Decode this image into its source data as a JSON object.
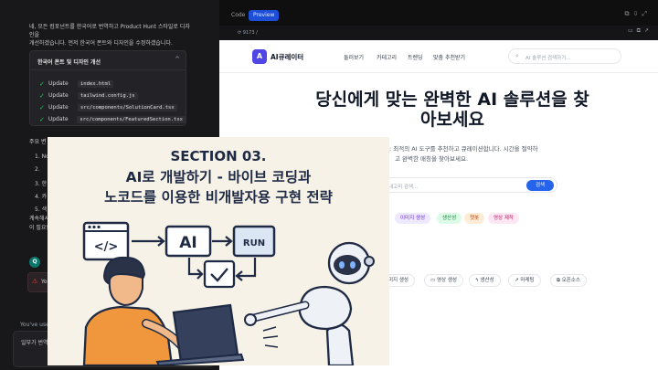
{
  "chat": {
    "intro_line1": "네, 모든 컴포넌트를 한국어로 번역하고 Product Hunt 스타일로 디자인을",
    "intro_line2": "개선하겠습니다. 먼저 한국어 폰트와 디자인을 수정하겠습니다.",
    "task_title": "한국어 폰트 및 디자인 개선",
    "task_toggle": "^",
    "tasks": [
      {
        "verb": "Update",
        "file": "index.html"
      },
      {
        "verb": "Update",
        "file": "tailwind.config.js"
      },
      {
        "verb": "Update",
        "file": "src/components/SolutionCard.tsx"
      },
      {
        "verb": "Update",
        "file": "src/components/FeaturedSection.tsx"
      }
    ],
    "section_title": "주요 변",
    "numbered": [
      "1. No",
      "2.",
      "3. 한",
      "4. 카",
      "5. 색"
    ],
    "tail_line1": "계속해서",
    "tail_line2": "이 필요한",
    "q_badge": "Q",
    "error_icon": "⚠",
    "error_text": "Yo",
    "usage_notice": "You've used",
    "compose_text": "일부가 번역이"
  },
  "ide": {
    "tab_code": "Code",
    "tab_preview": "Preview",
    "url": "⟳ 9173 /"
  },
  "site": {
    "logo_letter": "A",
    "logo_text": "AI큐레이터",
    "nav": [
      "둘러보기",
      "카테고리",
      "트렌딩",
      "맞춤 추천받기"
    ],
    "nav_search_placeholder": "AI 솔루션 검색하기...",
    "hero_line1": "당신에게 맞는 완벽한 AI 솔루션을 찾",
    "hero_line2": "아보세요",
    "hero_sub1": ": 최적의 AI 도구를 추천하고 큐레이션합니다. 시간을 절약하",
    "hero_sub2": "고 완벽한 매칭을 찾아보세요.",
    "hero_search_placeholder": "내고리 검색...",
    "search_button": "검색",
    "chips": [
      {
        "label": "이미지 생성",
        "bg": "#ede9fe",
        "fg": "#6d28d9"
      },
      {
        "label": "생산성",
        "bg": "#dcfce7",
        "fg": "#15803d"
      },
      {
        "label": "챗봇",
        "bg": "#ffedd5",
        "fg": "#c2410c"
      },
      {
        "label": "영상 제작",
        "bg": "#fce7f3",
        "fg": "#be185d"
      }
    ],
    "categories": [
      "미지 생성",
      "영상 생성",
      "생산성",
      "마케팅",
      "오픈소스"
    ]
  },
  "card": {
    "section": "SECTION 03.",
    "title_line1": "AI로 개발하기 - 바이브 코딩과",
    "title_line2": "노코드를 이용한 비개발자용 구현 전략",
    "code_symbol": "</>",
    "ai_label": "AI",
    "run_label": "RUN"
  }
}
